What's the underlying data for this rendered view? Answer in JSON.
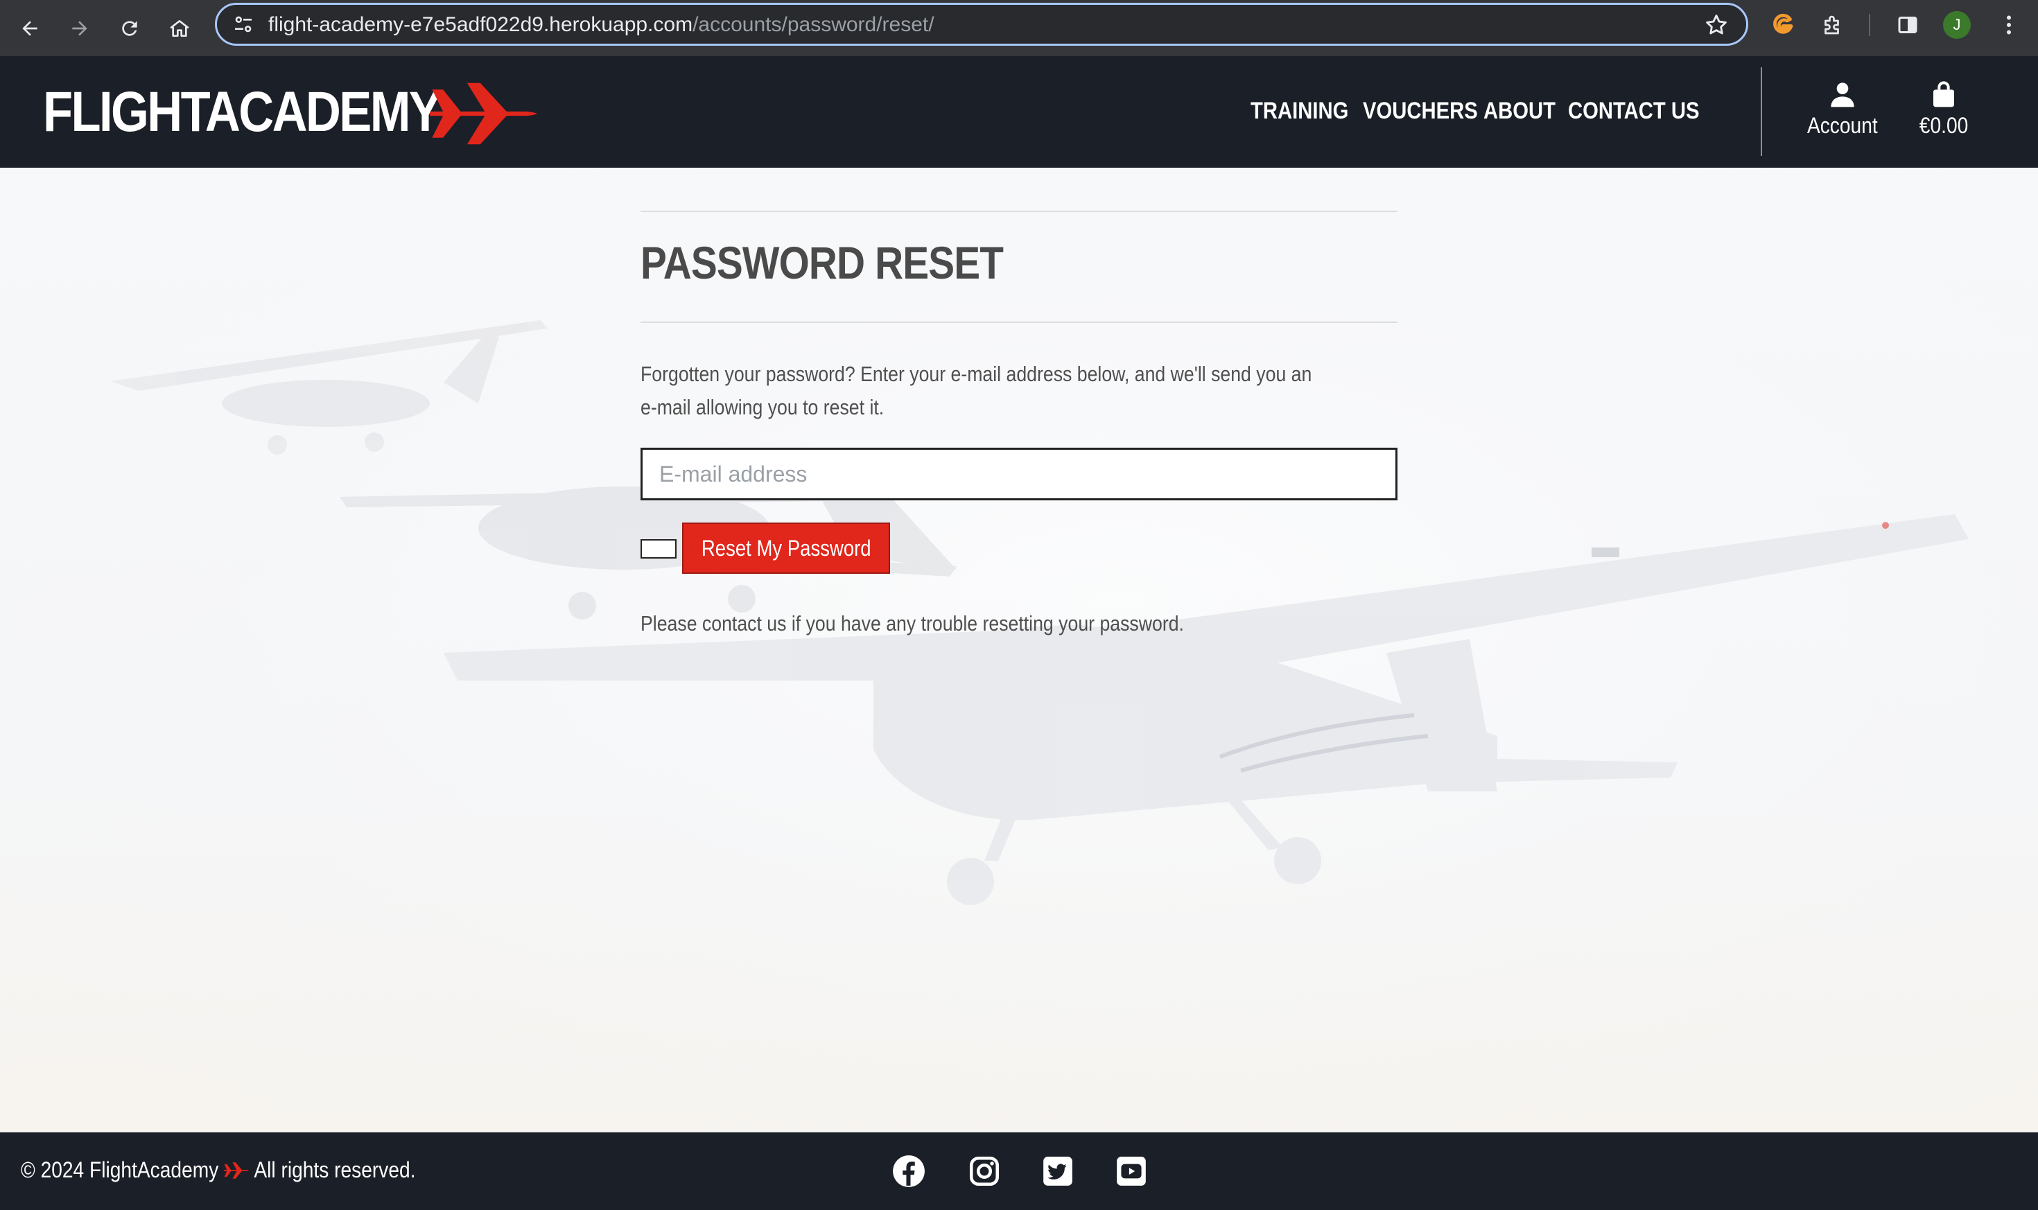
{
  "browser": {
    "url_host": "flight-academy-e7e5adf022d9.herokuapp.com",
    "url_path": "/accounts/password/reset/",
    "profile_initial": "J",
    "icons": [
      "back-icon",
      "forward-icon",
      "reload-icon",
      "home-icon",
      "site-info-icon",
      "bookmark-star-icon",
      "extension-g-icon",
      "extensions-puzzle-icon",
      "side-panel-icon",
      "menu-dots-icon"
    ]
  },
  "header": {
    "logo_text": "FLIGHTACADEMY",
    "nav": {
      "training": "TRAINING",
      "vouchers": "VOUCHERS",
      "about": "ABOUT",
      "contact": "CONTACT US"
    },
    "account_label": "Account",
    "basket_total": "€0.00"
  },
  "main": {
    "title": "PASSWORD RESET",
    "intro": "Forgotten your password? Enter your e-mail address below, and we'll send you an e-mail allowing you to reset it.",
    "email_placeholder": "E-mail address",
    "email_value": "",
    "reset_button": "Reset My Password",
    "help_text": "Please contact us if you have any trouble resetting your password."
  },
  "footer": {
    "copyright_prefix": "© 2024 FlightAcademy",
    "copyright_suffix": "All rights reserved.",
    "social": [
      "facebook-icon",
      "instagram-icon",
      "twitter-icon",
      "youtube-icon"
    ]
  },
  "colors": {
    "header_bg": "#1b1f27",
    "accent_red": "#e1261c",
    "chrome_bg": "#35363a"
  }
}
